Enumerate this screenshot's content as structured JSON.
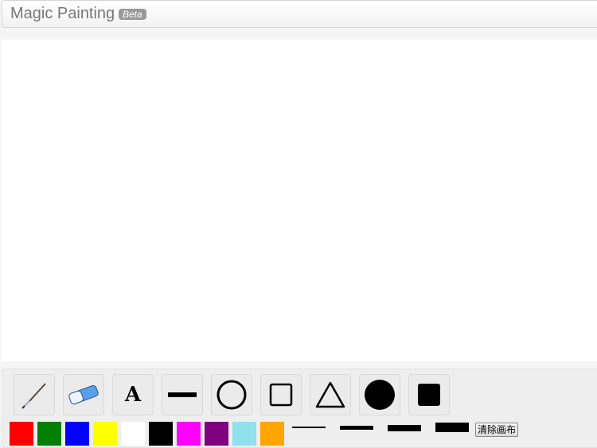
{
  "header": {
    "title": "Magic Painting",
    "badge": "Beta"
  },
  "tools": [
    {
      "name": "brush-icon"
    },
    {
      "name": "eraser-icon"
    },
    {
      "name": "text-icon",
      "label": "A"
    },
    {
      "name": "line-icon"
    },
    {
      "name": "circle-icon"
    },
    {
      "name": "rectangle-icon"
    },
    {
      "name": "triangle-icon"
    },
    {
      "name": "filled-circle-icon"
    },
    {
      "name": "filled-square-icon"
    }
  ],
  "colors": [
    "#ff0000",
    "#008000",
    "#0000ff",
    "#ffff00",
    "#ffffff",
    "#000000",
    "#ff00ff",
    "#800080",
    "#90e0ee",
    "#ffa500"
  ],
  "line_widths": [
    "thin",
    "medium",
    "thick",
    "extra-thick"
  ],
  "clear_button": "清除画布"
}
